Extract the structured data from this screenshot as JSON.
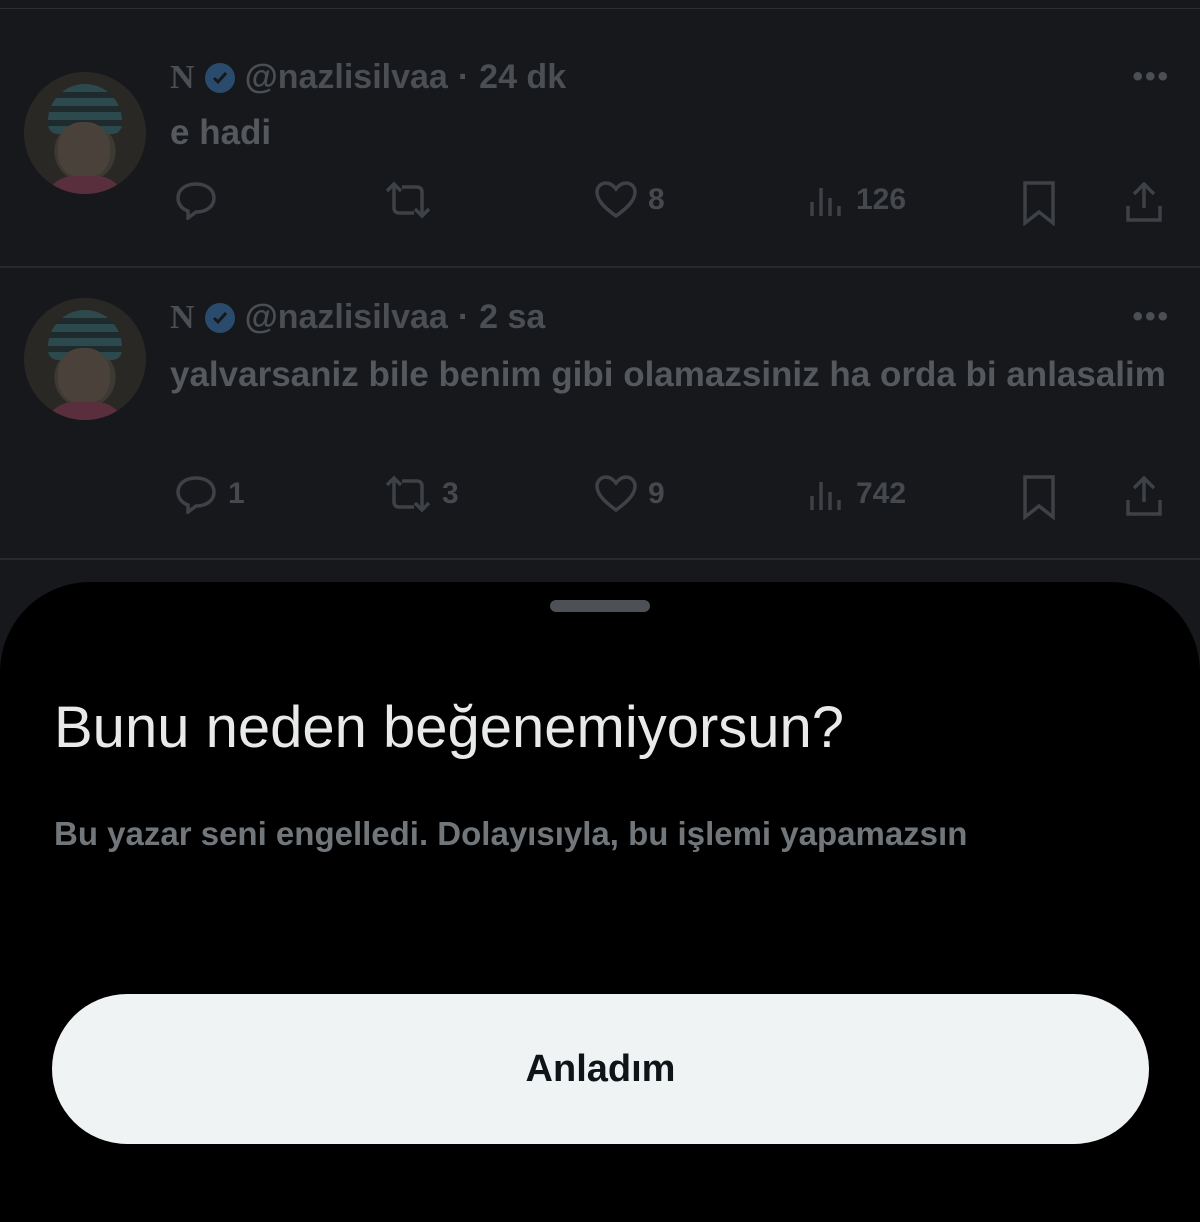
{
  "tweets": [
    {
      "name": "N",
      "handle": "@nazlisilvaa",
      "time": "24 dk",
      "text": "e hadi",
      "replies": "",
      "retweets": "",
      "likes": "8",
      "views": "126"
    },
    {
      "name": "N",
      "handle": "@nazlisilvaa",
      "time": "2 sa",
      "text": "yalvarsaniz bile benim gibi olamazsiniz ha orda bi anlasalim",
      "replies": "1",
      "retweets": "3",
      "likes": "9",
      "views": "742"
    }
  ],
  "separator": "·",
  "sheet": {
    "title": "Bunu neden beğenemiyorsun?",
    "message": "Bu yazar seni engelledi. Dolayısıyla, bu işlemi yapamazsın",
    "button_label": "Anladım"
  },
  "colors": {
    "sheet_background": "#000000",
    "button_background": "#eff3f4",
    "dimmed_feed": "#16181b"
  },
  "icons": [
    "verified-badge-icon",
    "more-icon",
    "reply-icon",
    "retweet-icon",
    "like-icon",
    "views-icon",
    "bookmark-icon",
    "share-icon"
  ]
}
